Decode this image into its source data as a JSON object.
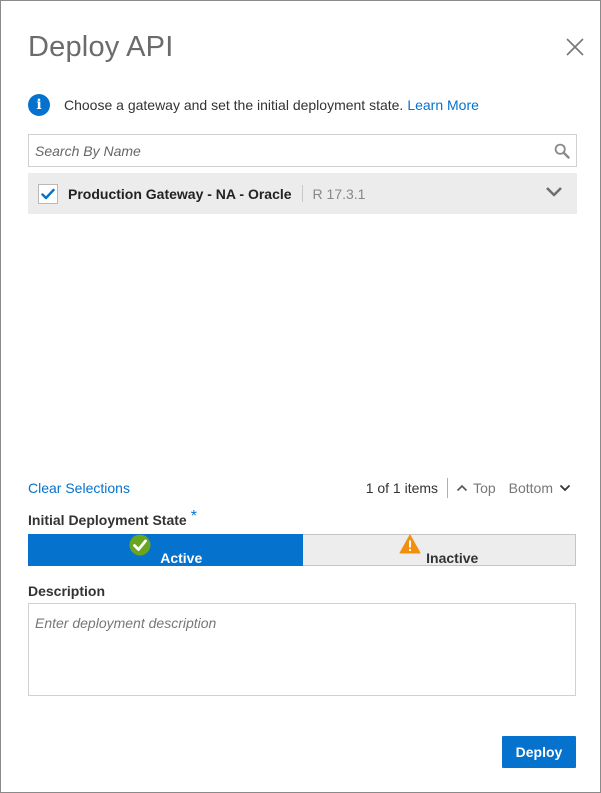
{
  "dialog": {
    "title": "Deploy API"
  },
  "info": {
    "text": "Choose a gateway and set the initial deployment state.",
    "link_label": "Learn More"
  },
  "search": {
    "placeholder": "Search By Name",
    "value": ""
  },
  "gateways": [
    {
      "name": "Production Gateway - NA - Oracle",
      "version": "R 17.3.1",
      "checked": true
    }
  ],
  "list_footer": {
    "clear_label": "Clear Selections",
    "count_label": "1 of 1 items",
    "top_label": "Top",
    "bottom_label": "Bottom"
  },
  "deployment_state": {
    "label": "Initial Deployment State",
    "required_mark": "*",
    "options": [
      {
        "label": "Active",
        "selected": true,
        "icon": "check-circle-icon"
      },
      {
        "label": "Inactive",
        "selected": false,
        "icon": "warning-triangle-icon"
      }
    ]
  },
  "description": {
    "label": "Description",
    "placeholder": "Enter deployment description",
    "value": ""
  },
  "actions": {
    "deploy_label": "Deploy"
  },
  "colors": {
    "accent": "#0572ce",
    "row_bg": "#ececec",
    "success": "#6aa520",
    "warning": "#f0900c"
  }
}
